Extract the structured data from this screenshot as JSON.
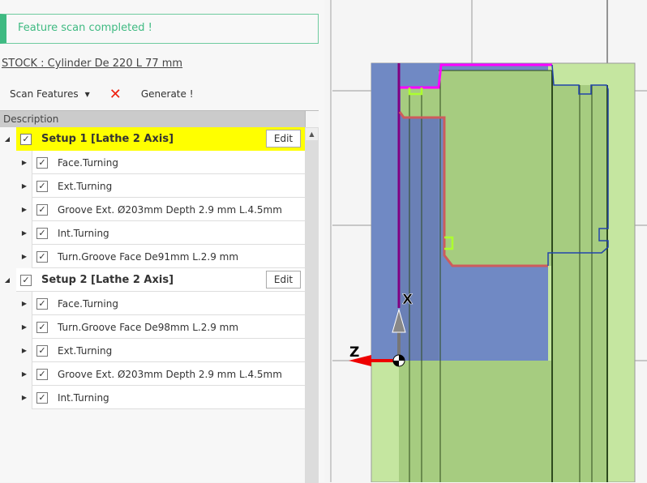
{
  "notification": "Feature scan completed !",
  "stock_label": "STOCK : Cylinder De 220 L 77 mm",
  "toolbar": {
    "scan": "Scan Features",
    "delete_icon": "✕",
    "generate": "Generate !"
  },
  "grid": {
    "header": "Description",
    "edit_label": "Edit",
    "setups": [
      {
        "label": "Setup 1 [Lathe 2 Axis]",
        "features": [
          "Face.Turning",
          "Ext.Turning",
          "Groove Ext. Ø203mm Depth 2.9 mm L.4.5mm",
          "Int.Turning",
          "Turn.Groove Face De91mm L.2.9 mm"
        ]
      },
      {
        "label": "Setup 2 [Lathe 2 Axis]",
        "features": [
          "Face.Turning",
          "Turn.Groove Face De98mm L.2.9 mm",
          "Ext.Turning",
          "Groove Ext. Ø203mm Depth 2.9 mm L.4.5mm",
          "Int.Turning"
        ]
      }
    ]
  },
  "viewport": {
    "axis_x": "X",
    "axis_z": "Z"
  },
  "colors": {
    "success": "#3fba82",
    "selected": "#ffff00",
    "stock": "#c5e6a0",
    "part": "#a6cc80",
    "blue": "#6f86c0"
  }
}
